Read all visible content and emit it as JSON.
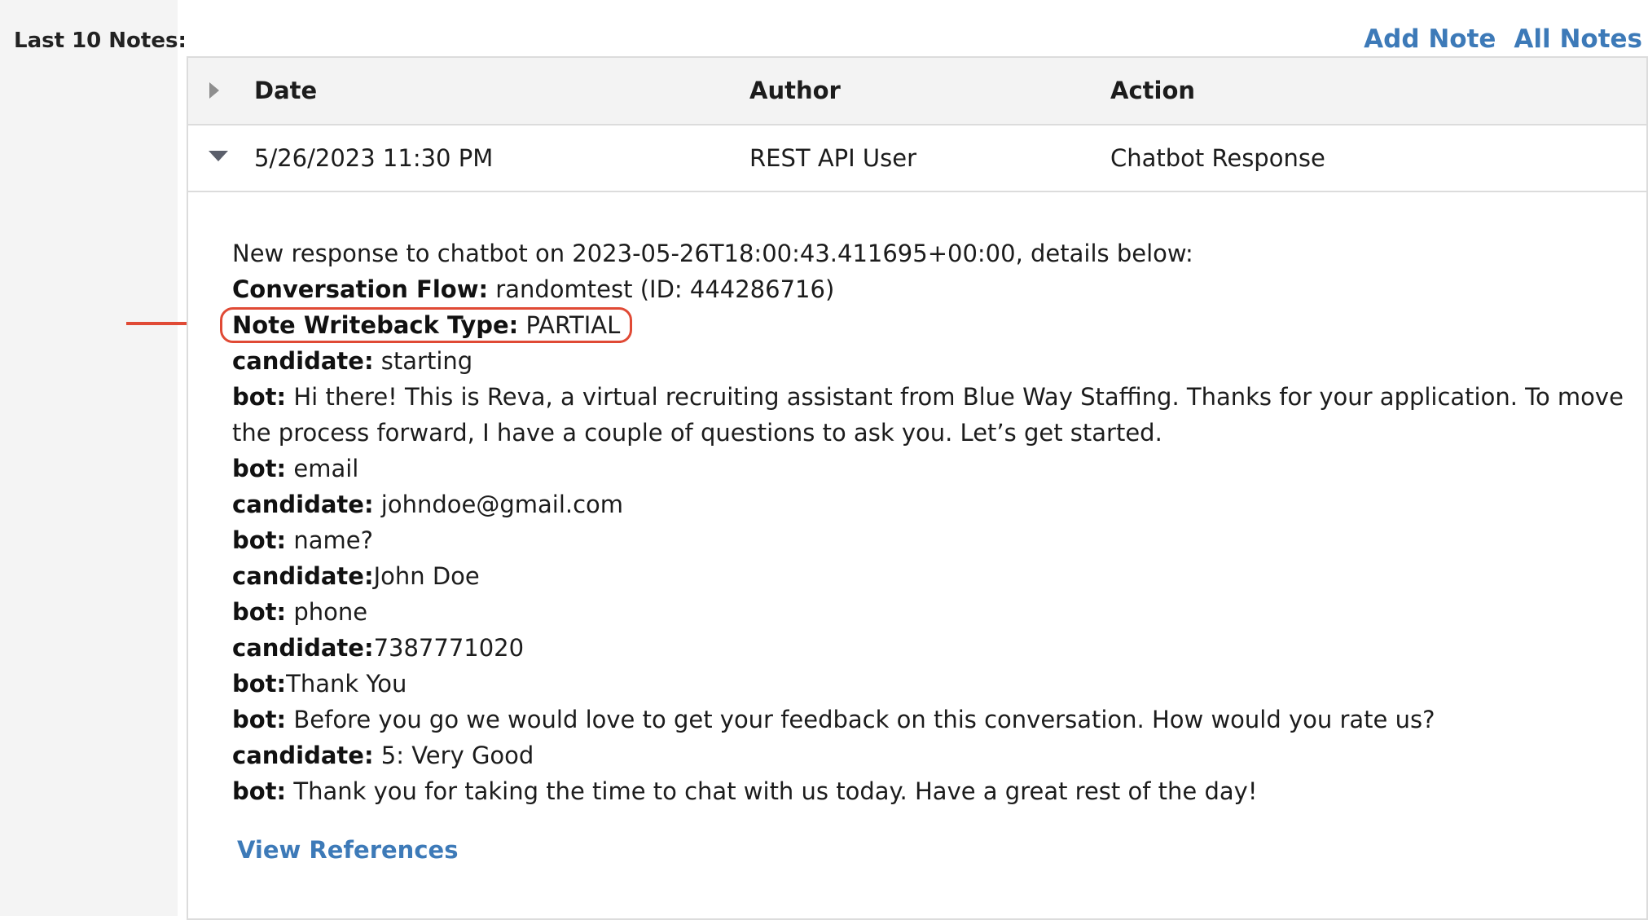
{
  "section": {
    "label": "Last 10 Notes:"
  },
  "links": {
    "add_note": "Add Note",
    "all_notes": "All Notes"
  },
  "table": {
    "headers": {
      "date": "Date",
      "author": "Author",
      "action": "Action"
    },
    "rows": [
      {
        "date": "5/26/2023 11:30 PM",
        "author": "REST API User",
        "action": "Chatbot Response",
        "expanded": true
      }
    ]
  },
  "note": {
    "intro": "New response to chatbot on 2023-05-26T18:00:43.411695+00:00, details below:",
    "lines": [
      {
        "label": "Conversation Flow:",
        "text": " randomtest (ID: 444286716)"
      },
      {
        "label": "Note Writeback Type:",
        "text": " PARTIAL"
      },
      {
        "label": "candidate:",
        "text": " starting"
      },
      {
        "label": "bot:",
        "text": " Hi there! This is Reva, a virtual recruiting assistant from Blue Way Staffing. Thanks for your application. To move the process forward, I have a couple of questions to ask you. Let’s get started."
      },
      {
        "label": "bot:",
        "text": " email"
      },
      {
        "label": "candidate:",
        "text": " johndoe@gmail.com"
      },
      {
        "label": "bot:",
        "text": " name?"
      },
      {
        "label": "candidate:",
        "text": "John Doe"
      },
      {
        "label": "bot:",
        "text": " phone"
      },
      {
        "label": "candidate:",
        "text": "7387771020"
      },
      {
        "label": "bot:",
        "text": "Thank You"
      },
      {
        "label": "bot:",
        "text": " Before you go we would love to get your feedback on this conversation. How would you rate us?"
      },
      {
        "label": "candidate:",
        "text": " 5: Very Good"
      },
      {
        "label": "bot:",
        "text": " Thank you for taking the time to chat with us today. Have a great rest of the day!"
      }
    ],
    "view_references": "View References"
  },
  "colors": {
    "link": "#3d7ab8",
    "highlight": "#e04a35",
    "header_bg": "#f3f3f3",
    "sidebar_bg": "#f4f4f4"
  },
  "icons": {
    "collapsed": "triangle-right-icon",
    "expanded": "triangle-down-icon",
    "annotation": "red-arrow-icon"
  }
}
